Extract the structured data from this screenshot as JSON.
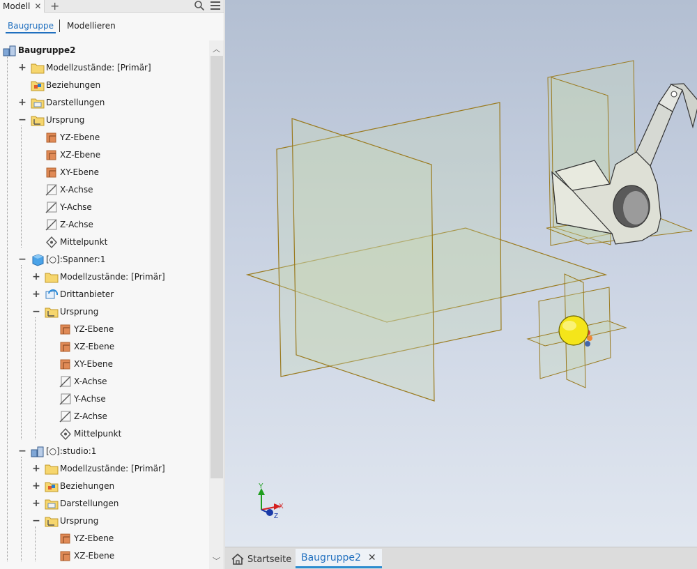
{
  "panel": {
    "tab_label": "Modell",
    "close_glyph": "✕",
    "add_glyph": "+",
    "modes": {
      "assembly": "Baugruppe",
      "modeling": "Modellieren"
    }
  },
  "tree": [
    {
      "label": "Baugruppe2",
      "depth": 0,
      "icon": "assembly-icon",
      "expander": "",
      "bold": true
    },
    {
      "label": "Modellzustände: [Primär]",
      "depth": 1,
      "icon": "folder-icon",
      "expander": "+"
    },
    {
      "label": "Beziehungen",
      "depth": 1,
      "icon": "relationships-folder-icon",
      "expander": ""
    },
    {
      "label": "Darstellungen",
      "depth": 1,
      "icon": "representations-folder-icon",
      "expander": "+"
    },
    {
      "label": "Ursprung",
      "depth": 1,
      "icon": "origin-folder-icon",
      "expander": "−"
    },
    {
      "label": "YZ-Ebene",
      "depth": 2,
      "icon": "plane-icon",
      "expander": ""
    },
    {
      "label": "XZ-Ebene",
      "depth": 2,
      "icon": "plane-icon",
      "expander": ""
    },
    {
      "label": "XY-Ebene",
      "depth": 2,
      "icon": "plane-icon",
      "expander": ""
    },
    {
      "label": "X-Achse",
      "depth": 2,
      "icon": "axis-icon",
      "expander": ""
    },
    {
      "label": "Y-Achse",
      "depth": 2,
      "icon": "axis-icon",
      "expander": ""
    },
    {
      "label": "Z-Achse",
      "depth": 2,
      "icon": "axis-icon",
      "expander": ""
    },
    {
      "label": "Mittelpunkt",
      "depth": 2,
      "icon": "center-point-icon",
      "expander": ""
    },
    {
      "label": "[○]:Spanner:1",
      "depth": 1,
      "icon": "part-icon",
      "expander": "−"
    },
    {
      "label": "Modellzustände: [Primär]",
      "depth": 2,
      "icon": "folder-icon",
      "expander": "+"
    },
    {
      "label": "Drittanbieter",
      "depth": 2,
      "icon": "third-party-icon",
      "expander": "+"
    },
    {
      "label": "Ursprung",
      "depth": 2,
      "icon": "origin-folder-icon",
      "expander": "−"
    },
    {
      "label": "YZ-Ebene",
      "depth": 3,
      "icon": "plane-icon",
      "expander": ""
    },
    {
      "label": "XZ-Ebene",
      "depth": 3,
      "icon": "plane-icon",
      "expander": ""
    },
    {
      "label": "XY-Ebene",
      "depth": 3,
      "icon": "plane-icon",
      "expander": ""
    },
    {
      "label": "X-Achse",
      "depth": 3,
      "icon": "axis-icon",
      "expander": ""
    },
    {
      "label": "Y-Achse",
      "depth": 3,
      "icon": "axis-icon",
      "expander": ""
    },
    {
      "label": "Z-Achse",
      "depth": 3,
      "icon": "axis-icon",
      "expander": ""
    },
    {
      "label": "Mittelpunkt",
      "depth": 3,
      "icon": "center-point-icon",
      "expander": ""
    },
    {
      "label": "[○]:studio:1",
      "depth": 1,
      "icon": "assembly-icon",
      "expander": "−"
    },
    {
      "label": "Modellzustände: [Primär]",
      "depth": 2,
      "icon": "folder-icon",
      "expander": "+"
    },
    {
      "label": "Beziehungen",
      "depth": 2,
      "icon": "relationships-folder-icon",
      "expander": "+"
    },
    {
      "label": "Darstellungen",
      "depth": 2,
      "icon": "representations-folder-icon",
      "expander": "+"
    },
    {
      "label": "Ursprung",
      "depth": 2,
      "icon": "origin-folder-icon",
      "expander": "−"
    },
    {
      "label": "YZ-Ebene",
      "depth": 3,
      "icon": "plane-icon",
      "expander": ""
    },
    {
      "label": "XZ-Ebene",
      "depth": 3,
      "icon": "plane-icon",
      "expander": ""
    }
  ],
  "viewport": {
    "triad": {
      "x_label": "X",
      "y_label": "Y",
      "z_label": "Z"
    }
  },
  "doc_tabs": {
    "home": "Startseite",
    "active": "Baugruppe2",
    "close_glyph": "✕"
  },
  "colors": {
    "accent": "#1f6fbf",
    "plane_edge": "#9a7a1e",
    "plane_fill": "#c8d8b8",
    "axis_x": "#d42020",
    "axis_y": "#1e9e1e",
    "axis_z": "#1a3aa8",
    "sphere": "#f4e51a"
  }
}
